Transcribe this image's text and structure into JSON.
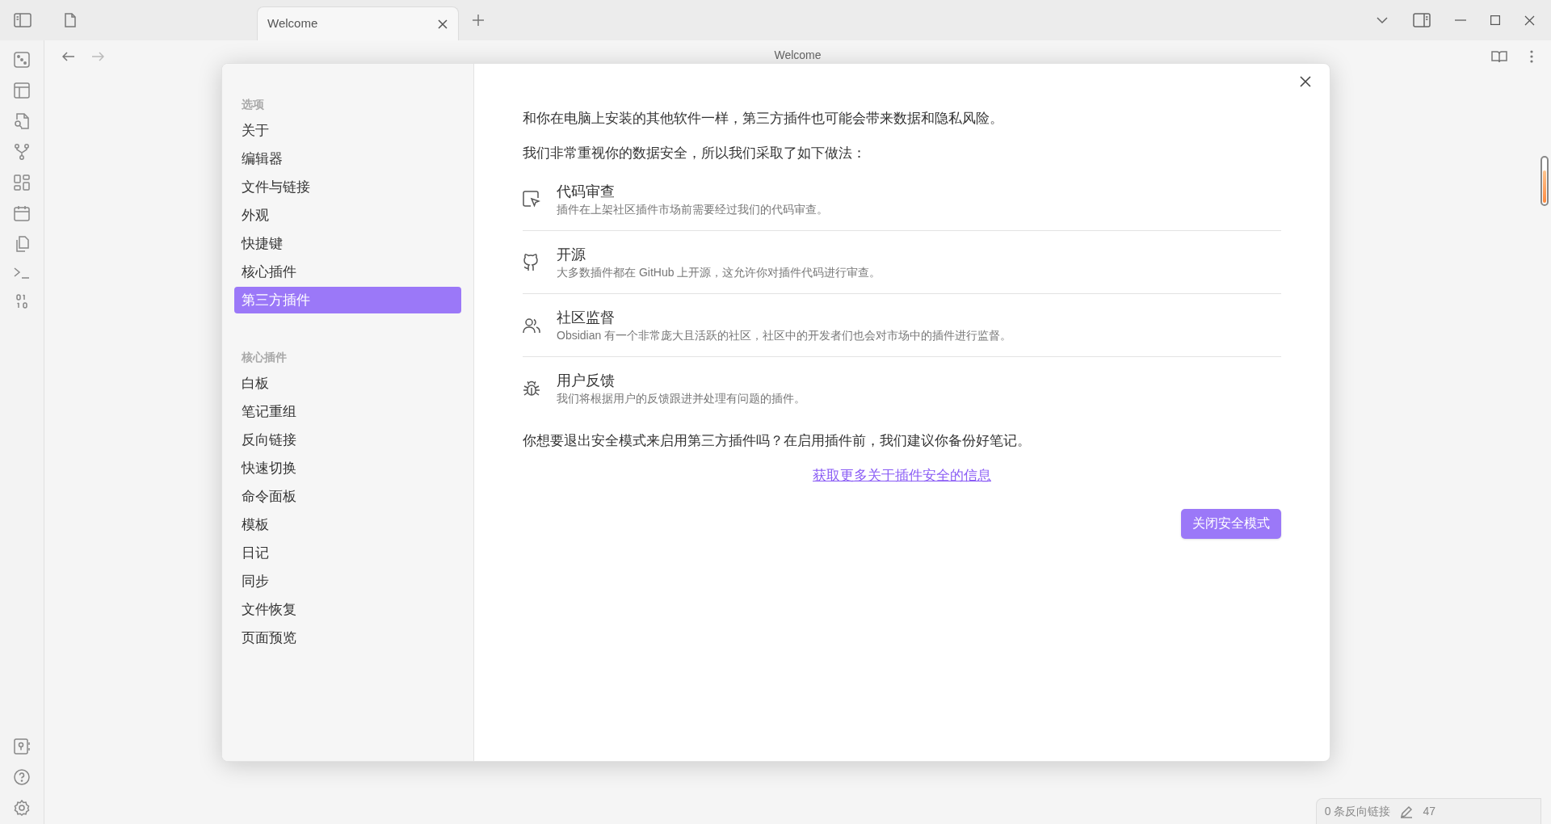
{
  "tab": {
    "title": "Welcome",
    "selected": true
  },
  "view_title": "Welcome",
  "settings_nav": [
    {
      "heading": "选项",
      "items": [
        {
          "label": "关于",
          "selected": false
        },
        {
          "label": "编辑器",
          "selected": false
        },
        {
          "label": "文件与链接",
          "selected": false
        },
        {
          "label": "外观",
          "selected": false
        },
        {
          "label": "快捷键",
          "selected": false
        },
        {
          "label": "核心插件",
          "selected": false
        },
        {
          "label": "第三方插件",
          "selected": true
        }
      ]
    },
    {
      "heading": "核心插件",
      "items": [
        {
          "label": "白板",
          "selected": false
        },
        {
          "label": "笔记重组",
          "selected": false
        },
        {
          "label": "反向链接",
          "selected": false
        },
        {
          "label": "快速切换",
          "selected": false
        },
        {
          "label": "命令面板",
          "selected": false
        },
        {
          "label": "模板",
          "selected": false
        },
        {
          "label": "日记",
          "selected": false
        },
        {
          "label": "同步",
          "selected": false
        },
        {
          "label": "文件恢复",
          "selected": false
        },
        {
          "label": "页面预览",
          "selected": false
        }
      ]
    }
  ],
  "content": {
    "intro": "和你在电脑上安装的其他软件一样，第三方插件也可能会带来数据和隐私风险。",
    "lead": "我们非常重视你的数据安全，所以我们采取了如下做法：",
    "measures": [
      {
        "title": "代码审查",
        "description": "插件在上架社区插件市场前需要经过我们的代码审查。"
      },
      {
        "title": "开源",
        "description": "大多数插件都在 GitHub 上开源，这允许你对插件代码进行审查。"
      },
      {
        "title": "社区监督",
        "description": "Obsidian 有一个非常庞大且活跃的社区，社区中的开发者们也会对市场中的插件进行监督。"
      },
      {
        "title": "用户反馈",
        "description": "我们将根据用户的反馈跟进并处理有问题的插件。"
      }
    ],
    "question": "你想要退出安全模式来启用第三方插件吗？在启用插件前，我们建议你备份好笔记。",
    "link": "获取更多关于插件安全的信息",
    "button": "关闭安全模式"
  },
  "status_bar": {
    "backlinks": "0 条反向链接",
    "word_count": "47"
  }
}
